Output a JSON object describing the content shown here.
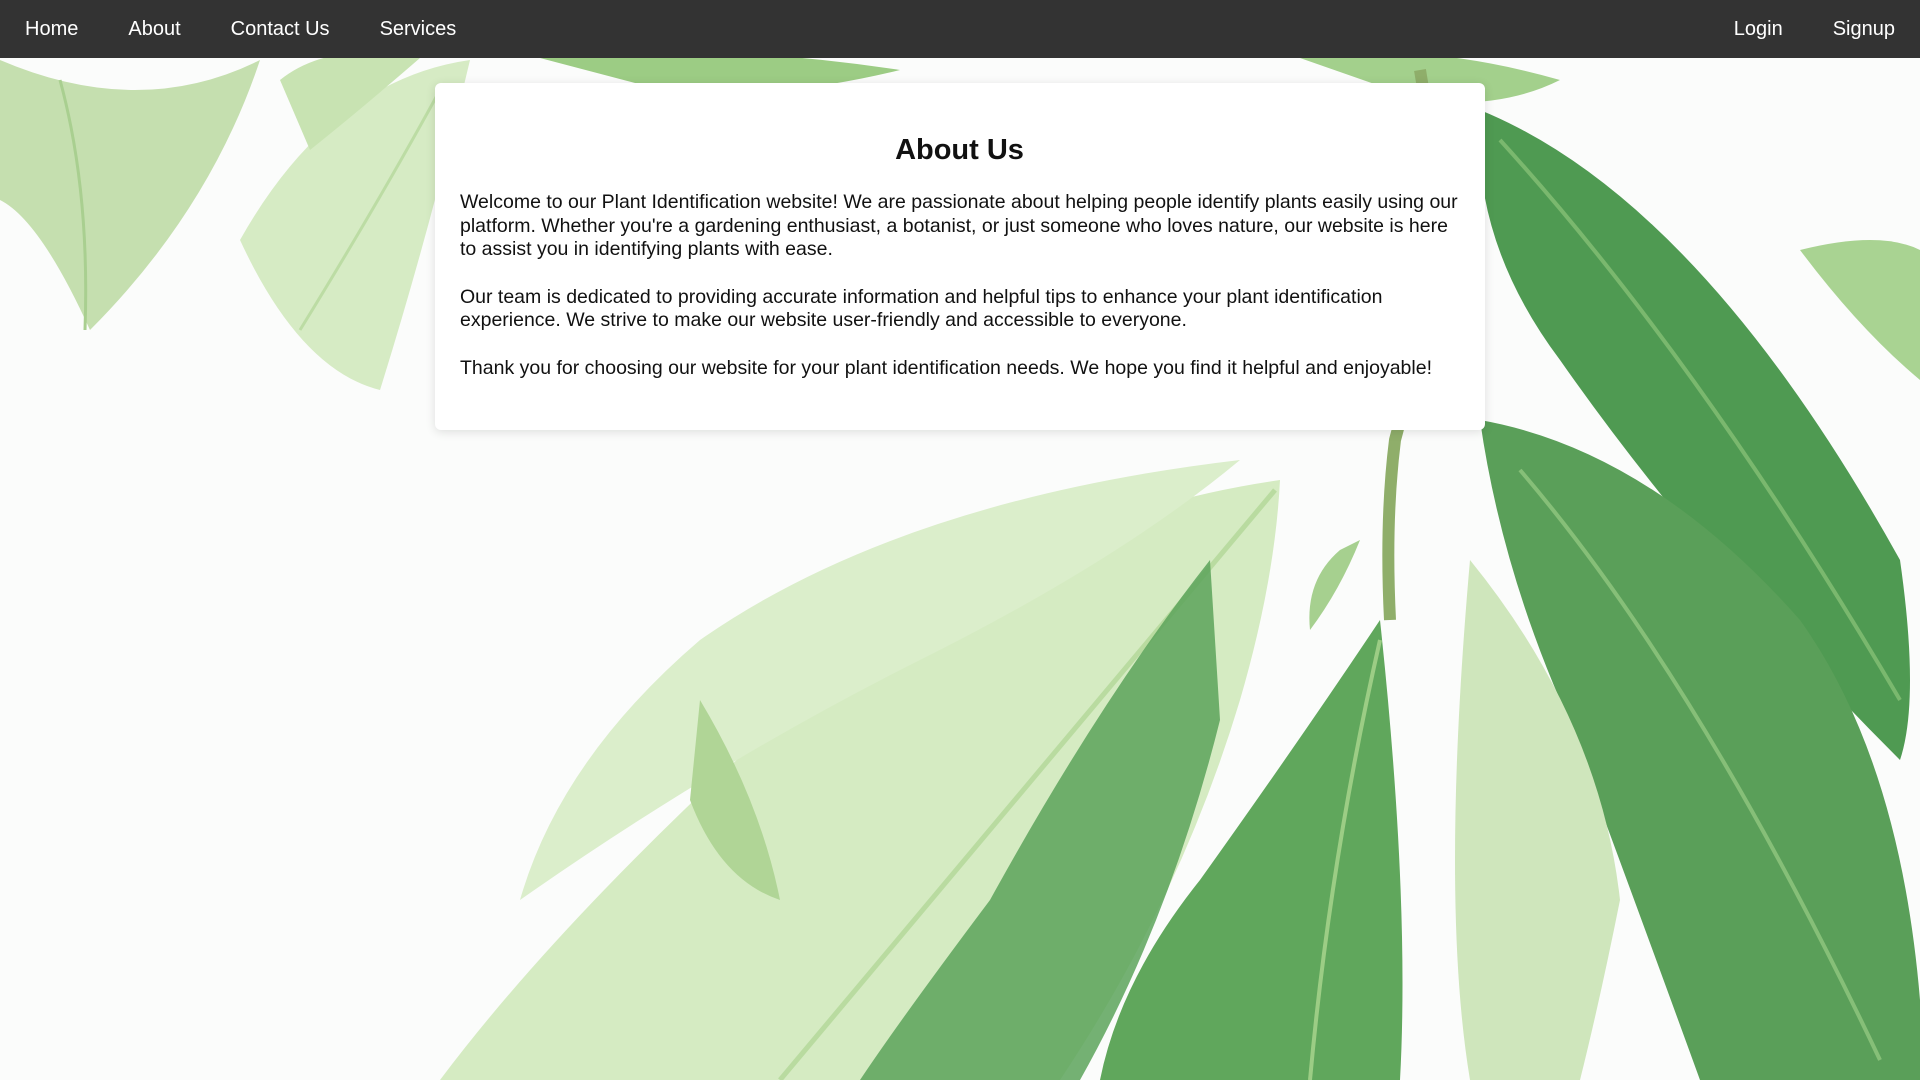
{
  "nav": {
    "left": [
      {
        "label": "Home"
      },
      {
        "label": "About"
      },
      {
        "label": "Contact Us"
      },
      {
        "label": "Services"
      }
    ],
    "right": [
      {
        "label": "Login"
      },
      {
        "label": "Signup"
      }
    ]
  },
  "about": {
    "title": "About Us",
    "paragraphs": [
      "Welcome to our Plant Identification website! We are passionate about helping people identify plants easily using our platform. Whether you're a gardening enthusiast, a botanist, or just someone who loves nature, our website is here to assist you in identifying plants with ease.",
      "Our team is dedicated to providing accurate information and helpful tips to enhance your plant identification experience. We strive to make our website user-friendly and accessible to everyone.",
      "Thank you for choosing our website for your plant identification needs. We hope you find it helpful and enjoyable!"
    ]
  },
  "colors": {
    "navbar": "#333333",
    "nav_text": "#ffffff",
    "card": "#ffffff",
    "leaf_light": "#cfe6b8",
    "leaf_mid": "#9fce86",
    "leaf_dark": "#5fa35a"
  }
}
